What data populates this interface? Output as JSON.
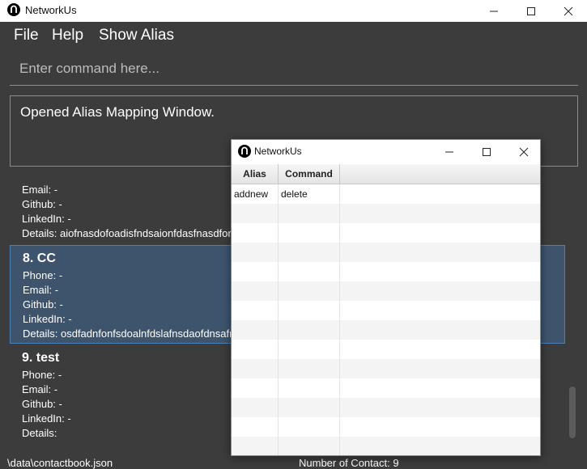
{
  "window": {
    "title": "NetworkUs"
  },
  "menu": {
    "file": "File",
    "help": "Help",
    "show_alias": "Show Alias"
  },
  "command": {
    "placeholder": "Enter command here..."
  },
  "result": {
    "message": "Opened Alias Mapping Window."
  },
  "contacts": [
    {
      "email": "Email: -",
      "github": "Github: -",
      "linkedin": "LinkedIn: -",
      "details": "Details: aiofnasdofoadisfndsaionfdasfnasdfonasdofnsdafnsdaofn"
    },
    {
      "name": "8.  CC",
      "phone": "Phone: -",
      "email": "Email: -",
      "github": "Github: -",
      "linkedin": "LinkedIn: -",
      "details": "Details: osdfadnfonfsdoalnfdslafnsdaofdnsafnsdaofnsdaofnadsofnsdaofnadsofnasdofn...",
      "selected": true
    },
    {
      "name": "9.  test",
      "phone": "Phone: -",
      "email": "Email: -",
      "github": "Github: -",
      "linkedin": "LinkedIn: -",
      "details": "Details:"
    }
  ],
  "status": {
    "file_path": "\\data\\contactbook.json",
    "count": "Number of Contact: 9"
  },
  "alias_window": {
    "title": "NetworkUs",
    "columns": [
      "Alias",
      "Command"
    ],
    "rows": [
      {
        "alias": "addnew",
        "command": "delete"
      }
    ]
  }
}
